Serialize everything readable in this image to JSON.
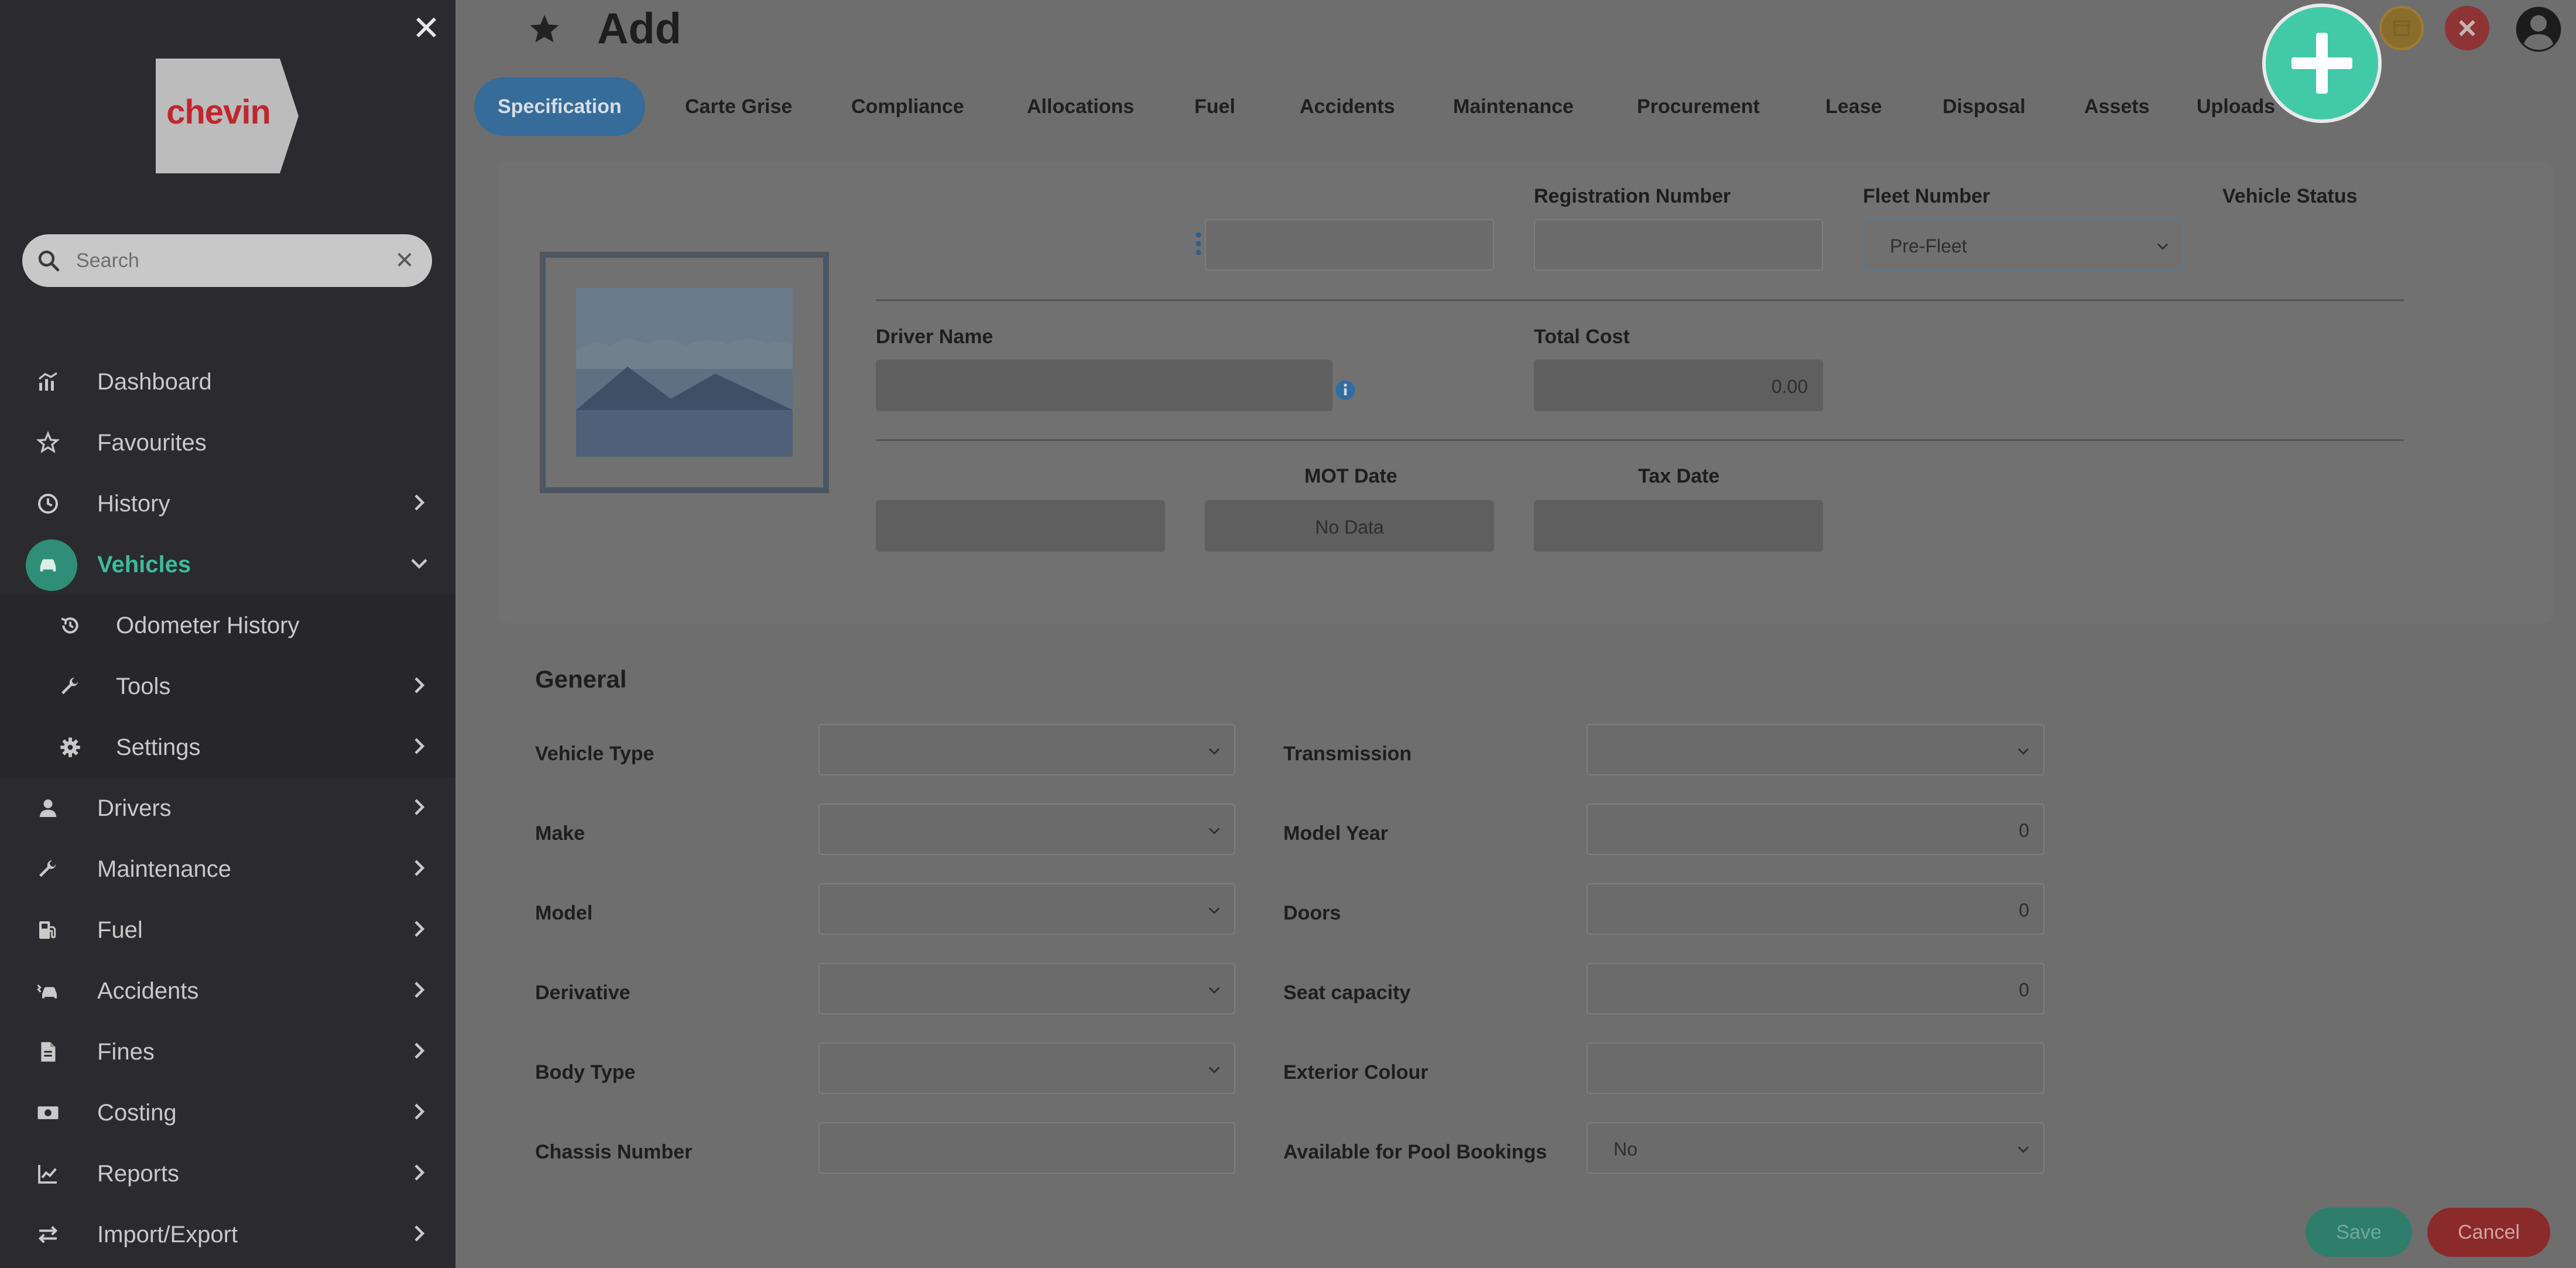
{
  "sidebar": {
    "close_glyph": "✕",
    "logo_text": "chevin",
    "search": {
      "placeholder": "Search",
      "clear_glyph": "✕"
    },
    "items": [
      {
        "label": "Dashboard",
        "icon": "dashboard-icon"
      },
      {
        "label": "Favourites",
        "icon": "star-outline-icon"
      },
      {
        "label": "History",
        "icon": "clock-icon"
      },
      {
        "label": "Vehicles",
        "icon": "car-icon",
        "active": true
      },
      {
        "label": "Odometer History",
        "icon": "history-icon"
      },
      {
        "label": "Tools",
        "icon": "wrench-icon"
      },
      {
        "label": "Settings",
        "icon": "gear-icon"
      },
      {
        "label": "Drivers",
        "icon": "person-icon"
      },
      {
        "label": "Maintenance",
        "icon": "wrench-icon"
      },
      {
        "label": "Fuel",
        "icon": "fuel-pump-icon"
      },
      {
        "label": "Accidents",
        "icon": "car-crash-icon"
      },
      {
        "label": "Fines",
        "icon": "document-icon"
      },
      {
        "label": "Costing",
        "icon": "money-icon"
      },
      {
        "label": "Reports",
        "icon": "line-chart-icon"
      },
      {
        "label": "Import/Export",
        "icon": "exchange-icon"
      }
    ]
  },
  "page": {
    "title": "Add"
  },
  "tabs": [
    "Specification",
    "Carte Grise",
    "Compliance",
    "Allocations",
    "Fuel",
    "Accidents",
    "Maintenance",
    "Procurement",
    "Lease",
    "Disposal",
    "Assets",
    "Uploads"
  ],
  "summary": {
    "registration_label": "Registration Number",
    "fleet_label": "Fleet Number",
    "fleet_value": "Pre-Fleet",
    "status_label": "Vehicle Status",
    "driver_label": "Driver Name",
    "total_cost_label": "Total Cost",
    "total_cost_value": "0.00",
    "mot_label": "MOT Date",
    "mot_value": "No Data",
    "tax_label": "Tax Date"
  },
  "general": {
    "title": "General",
    "left": [
      {
        "label": "Vehicle Type",
        "value": "",
        "type": "select"
      },
      {
        "label": "Make",
        "value": "",
        "type": "select"
      },
      {
        "label": "Model",
        "value": "",
        "type": "select"
      },
      {
        "label": "Derivative",
        "value": "",
        "type": "select"
      },
      {
        "label": "Body Type",
        "value": "",
        "type": "select"
      },
      {
        "label": "Chassis Number",
        "value": "",
        "type": "text"
      }
    ],
    "right": [
      {
        "label": "Transmission",
        "value": "",
        "type": "select"
      },
      {
        "label": "Model Year",
        "value": "0",
        "type": "number"
      },
      {
        "label": "Doors",
        "value": "0",
        "type": "number"
      },
      {
        "label": "Seat capacity",
        "value": "0",
        "type": "number"
      },
      {
        "label": "Exterior Colour",
        "value": "",
        "type": "text"
      },
      {
        "label": "Available for Pool Bookings",
        "value": "No",
        "type": "select"
      }
    ]
  },
  "footer": {
    "save_label": "Save",
    "cancel_label": "Cancel"
  },
  "colors": {
    "accent": "#42c9a8",
    "active_tab": "#356c99",
    "save": "#2f7d6b",
    "cancel": "#8a2a2a"
  }
}
